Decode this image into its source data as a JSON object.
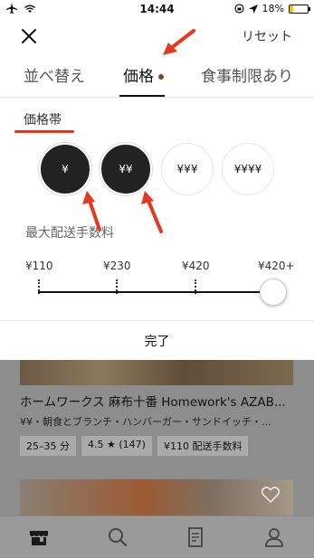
{
  "status_bar": {
    "time": "14:44",
    "battery": "18%",
    "battery_level": 0.18
  },
  "header": {
    "reset_label": "リセット"
  },
  "tabs": [
    {
      "label": "並べ替え",
      "active": false
    },
    {
      "label": "価格",
      "active": true
    },
    {
      "label": "食事制限あり",
      "active": false
    }
  ],
  "price_section": {
    "title": "価格帯",
    "options": [
      {
        "label": "¥",
        "selected": true
      },
      {
        "label": "¥¥",
        "selected": true
      },
      {
        "label": "¥¥¥",
        "selected": false
      },
      {
        "label": "¥¥¥¥",
        "selected": false
      }
    ]
  },
  "fee_section": {
    "title": "最大配送手数料",
    "labels": [
      "¥110",
      "¥230",
      "¥420",
      "¥420+"
    ],
    "selected_index": 3
  },
  "done_label": "完了",
  "background_listing": {
    "title": "ホームワークス 麻布十番 Homework's AZAB...",
    "subtitle": "¥¥・朝食とブランチ・ハンバーガー・サンドイッチ・...",
    "eta": "25–35 分",
    "rating": "4.5",
    "rating_count": "(147)",
    "delivery_fee": "¥110 配送手数料"
  },
  "colors": {
    "accent_red": "#e5391f",
    "selected_fill": "#222222",
    "tab_dot": "#7a4a2b"
  }
}
